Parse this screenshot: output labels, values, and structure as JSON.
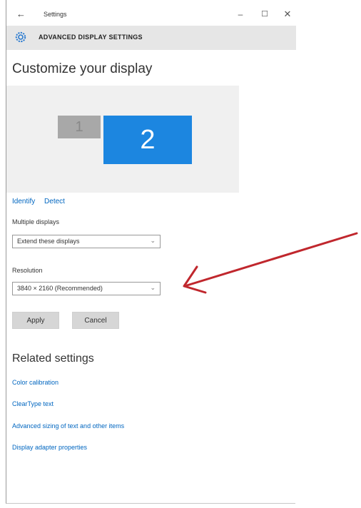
{
  "titlebar": {
    "back_glyph": "←",
    "app_title": "Settings",
    "minimize_glyph": "–",
    "maximize_glyph": "☐",
    "close_glyph": "✕"
  },
  "header": {
    "title": "ADVANCED DISPLAY SETTINGS"
  },
  "main": {
    "page_title": "Customize your display",
    "monitors": [
      {
        "label": "1",
        "color": "#a8a8a8"
      },
      {
        "label": "2",
        "color": "#1c86e0"
      }
    ],
    "links": {
      "identify": "Identify",
      "detect": "Detect"
    },
    "multiple_displays": {
      "label": "Multiple displays",
      "value": "Extend these displays",
      "chevron": "⌄"
    },
    "resolution": {
      "label": "Resolution",
      "value": "3840 × 2160 (Recommended)",
      "chevron": "⌄"
    },
    "buttons": {
      "apply": "Apply",
      "cancel": "Cancel"
    }
  },
  "related": {
    "title": "Related settings",
    "links": [
      "Color calibration",
      "ClearType text",
      "Advanced sizing of text and other items",
      "Display adapter properties"
    ]
  },
  "annotation": {
    "arrow_color": "#c0272d"
  }
}
